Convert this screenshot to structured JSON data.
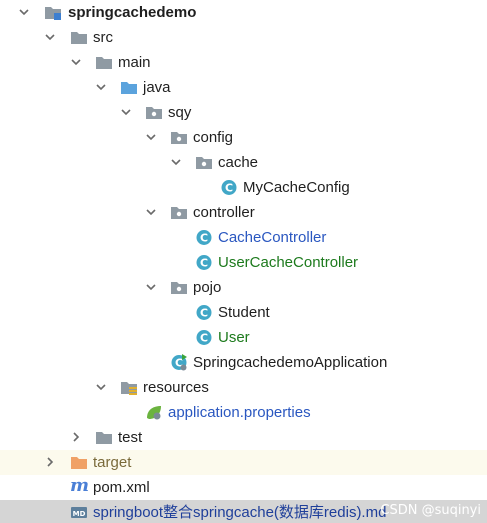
{
  "tree": {
    "project": "springcachedemo",
    "src": "src",
    "main": "main",
    "java": "java",
    "package": "sqy",
    "config": "config",
    "cache": "cache",
    "my_cache_config": "MyCacheConfig",
    "controller": "controller",
    "cache_controller": "CacheController",
    "user_cache_controller": "UserCacheController",
    "pojo": "pojo",
    "student": "Student",
    "user": "User",
    "application_class": "SpringcachedemoApplication",
    "resources": "resources",
    "application_properties": "application.properties",
    "test": "test",
    "target": "target",
    "pom": "pom.xml",
    "readme": "springboot整合springcache(数据库redis).md"
  },
  "watermark": "CSDN @suqinyi",
  "colors": {
    "modified_blue": "#2a57c0",
    "added_green": "#1d7a1d",
    "folder_gray": "#8f9aa3",
    "source_folder_blue": "#5ba3dd",
    "excluded_orange": "#f0a166",
    "class_teal": "#41a7c7"
  }
}
